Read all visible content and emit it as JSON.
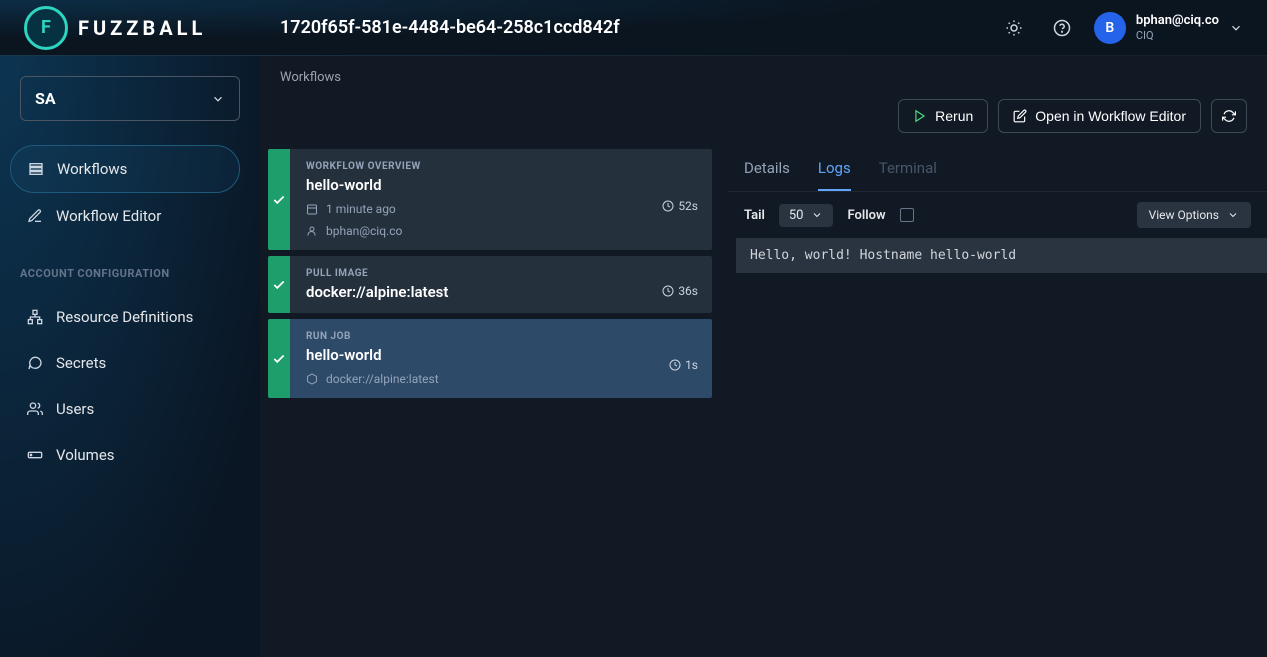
{
  "app": {
    "name": "FUZZBALL",
    "logo_letter": "F"
  },
  "header": {
    "page_title": "1720f65f-581e-4484-be64-258c1ccd842f",
    "user": {
      "initial": "B",
      "email": "bphan@ciq.co",
      "org": "CIQ"
    }
  },
  "sidebar": {
    "org_selector": "SA",
    "primary": [
      {
        "label": "Workflows",
        "icon": "list"
      },
      {
        "label": "Workflow Editor",
        "icon": "pencil"
      }
    ],
    "section_label": "ACCOUNT CONFIGURATION",
    "config": [
      {
        "label": "Resource Definitions",
        "icon": "sitemap"
      },
      {
        "label": "Secrets",
        "icon": "chat-lock"
      },
      {
        "label": "Users",
        "icon": "users"
      },
      {
        "label": "Volumes",
        "icon": "drive"
      }
    ]
  },
  "breadcrumb": "Workflows",
  "actions": {
    "rerun": "Rerun",
    "open_editor": "Open in Workflow Editor"
  },
  "steps": [
    {
      "kicker": "WORKFLOW OVERVIEW",
      "title": "hello-world",
      "duration": "52s",
      "meta1": "1 minute ago",
      "meta2": "bphan@ciq.co"
    },
    {
      "kicker": "PULL IMAGE",
      "title": "docker://alpine:latest",
      "duration": "36s"
    },
    {
      "kicker": "RUN JOB",
      "title": "hello-world",
      "duration": "1s",
      "meta1": "docker://alpine:latest"
    }
  ],
  "tabs": {
    "details": "Details",
    "logs": "Logs",
    "terminal": "Terminal"
  },
  "log_toolbar": {
    "tail_label": "Tail",
    "tail_value": "50",
    "follow_label": "Follow",
    "view_options": "View Options"
  },
  "log_output": "Hello, world! Hostname hello-world"
}
